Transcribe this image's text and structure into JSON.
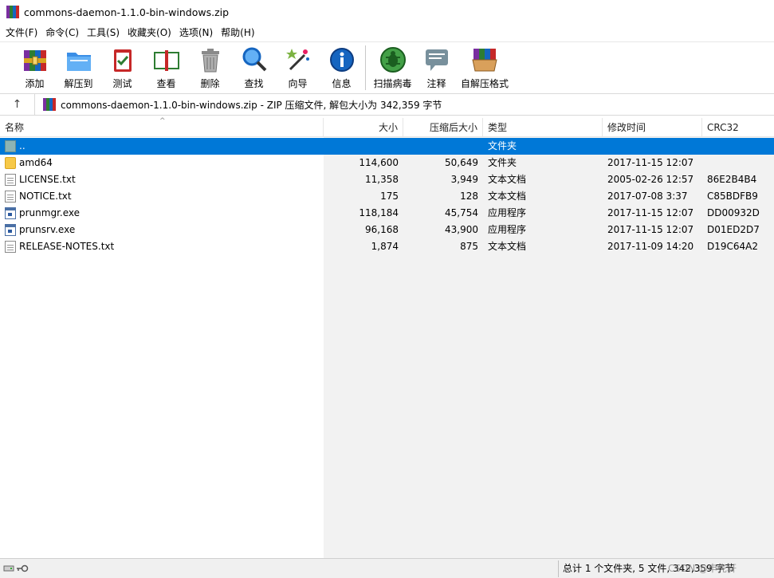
{
  "window": {
    "title": "commons-daemon-1.1.0-bin-windows.zip"
  },
  "menu": [
    "文件(F)",
    "命令(C)",
    "工具(S)",
    "收藏夹(O)",
    "选项(N)",
    "帮助(H)"
  ],
  "toolbar": {
    "add": "添加",
    "extract_to": "解压到",
    "test": "测试",
    "view": "查看",
    "delete": "删除",
    "find": "查找",
    "wizard": "向导",
    "info": "信息",
    "virus_scan": "扫描病毒",
    "comment": "注释",
    "sfx": "自解压格式"
  },
  "address": {
    "up_glyph": "↑",
    "path": "commons-daemon-1.1.0-bin-windows.zip - ZIP 压缩文件, 解包大小为 342,359 字节"
  },
  "columns": {
    "name": "名称",
    "size": "大小",
    "packed": "压缩后大小",
    "type": "类型",
    "modified": "修改时间",
    "crc": "CRC32",
    "sort_caret": "^"
  },
  "files": [
    {
      "name": "..",
      "size": "",
      "packed": "",
      "type": "文件夹",
      "modified": "",
      "crc": ""
    },
    {
      "name": "amd64",
      "size": "114,600",
      "packed": "50,649",
      "type": "文件夹",
      "modified": "2017-11-15 12:07",
      "crc": ""
    },
    {
      "name": "LICENSE.txt",
      "size": "11,358",
      "packed": "3,949",
      "type": "文本文档",
      "modified": "2005-02-26 12:57",
      "crc": "86E2B4B4"
    },
    {
      "name": "NOTICE.txt",
      "size": "175",
      "packed": "128",
      "type": "文本文档",
      "modified": "2017-07-08 3:37",
      "crc": "C85BDFB9"
    },
    {
      "name": "prunmgr.exe",
      "size": "118,184",
      "packed": "45,754",
      "type": "应用程序",
      "modified": "2017-11-15 12:07",
      "crc": "DD00932D"
    },
    {
      "name": "prunsrv.exe",
      "size": "96,168",
      "packed": "43,900",
      "type": "应用程序",
      "modified": "2017-11-15 12:07",
      "crc": "D01ED2D7"
    },
    {
      "name": "RELEASE-NOTES.txt",
      "size": "1,874",
      "packed": "875",
      "type": "文本文档",
      "modified": "2017-11-09 14:20",
      "crc": "D19C64A2"
    }
  ],
  "status": {
    "summary": "总计 1 个文件夹, 5 文件, 342,359 字节",
    "watermark": "CSDN @申先轩"
  },
  "colors": {
    "selection": "#0078d7",
    "folder": "#f7c948",
    "archive_stripes": [
      "#7a2ea0",
      "#2e7d32",
      "#1565c0",
      "#c62828"
    ]
  }
}
